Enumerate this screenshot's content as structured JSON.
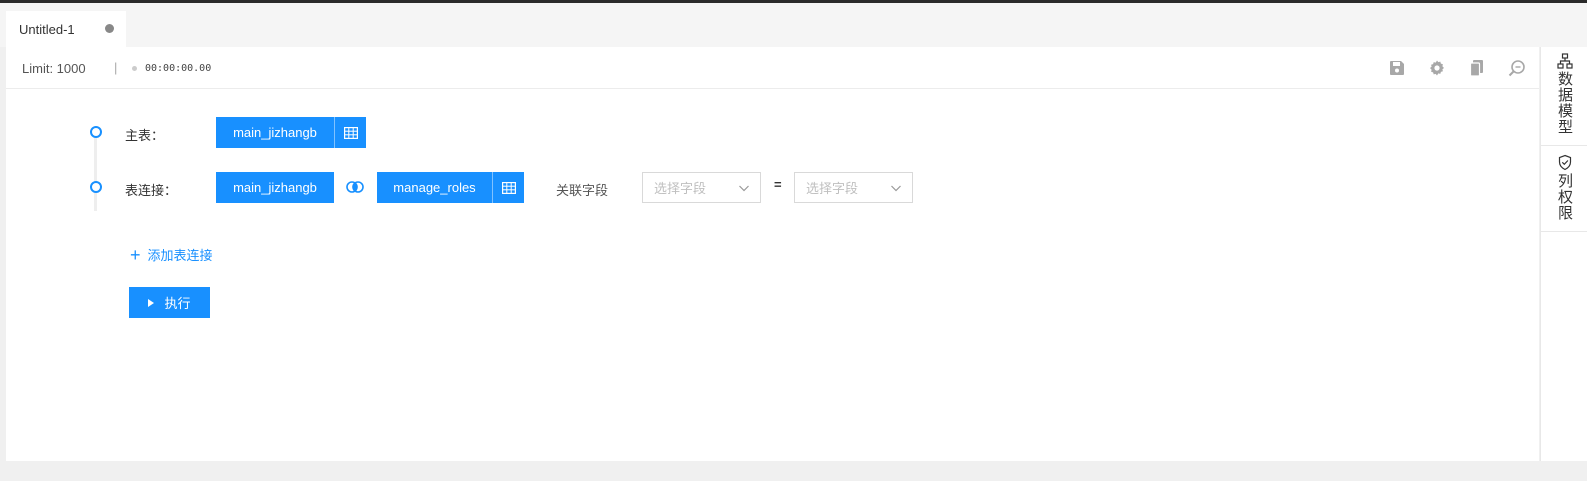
{
  "tab": {
    "title": "Untitled-1"
  },
  "toolbar": {
    "limit_label": "Limit: 1000",
    "separator": "|",
    "elapsed": "00:00:00.00",
    "icons": [
      "save-icon",
      "gear-icon",
      "copy-icon",
      "zoom-icon"
    ]
  },
  "query": {
    "main_label": "主表：",
    "main_table": "main_jizhangb",
    "join_label": "表连接：",
    "join_left_table": "main_jizhangb",
    "join_right_table": "manage_roles",
    "join_field_label": "关联字段",
    "field_left_placeholder": "选择字段",
    "equals": "=",
    "field_right_placeholder": "选择字段",
    "add_join_label": "添加表连接",
    "run_label": "执行"
  },
  "side": {
    "data_model": "数据模型",
    "column_permission": "列权限"
  },
  "colors": {
    "accent": "#1890ff",
    "tab_dot": "#888888"
  }
}
